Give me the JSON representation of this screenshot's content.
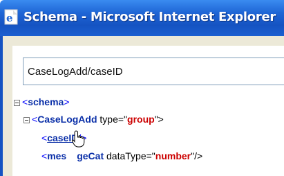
{
  "window": {
    "title": "Schema - Microsoft Internet Explorer"
  },
  "path_field": {
    "value": "CaseLogAdd/caseID"
  },
  "tree": {
    "schema_open": "<",
    "schema_tag": "schema",
    "schema_close": ">",
    "group_open": "<",
    "group_tag": "CaseLogAdd",
    "group_attr": " type=\"",
    "group_val": "group",
    "group_end": "\">",
    "case_open": "<",
    "case_tag": "caseID",
    "case_close": "/>",
    "msg_open": "<",
    "msg_tag_start": "mes",
    "msg_tag_end": "geCat",
    "msg_attr": " dataType=\"",
    "msg_val": "number",
    "msg_end": "\"/>"
  },
  "colors": {
    "title_bar": "#1f66d6",
    "window_frame": "#ece9d8",
    "tag_color": "#990000",
    "value_color": "#cc0000"
  }
}
